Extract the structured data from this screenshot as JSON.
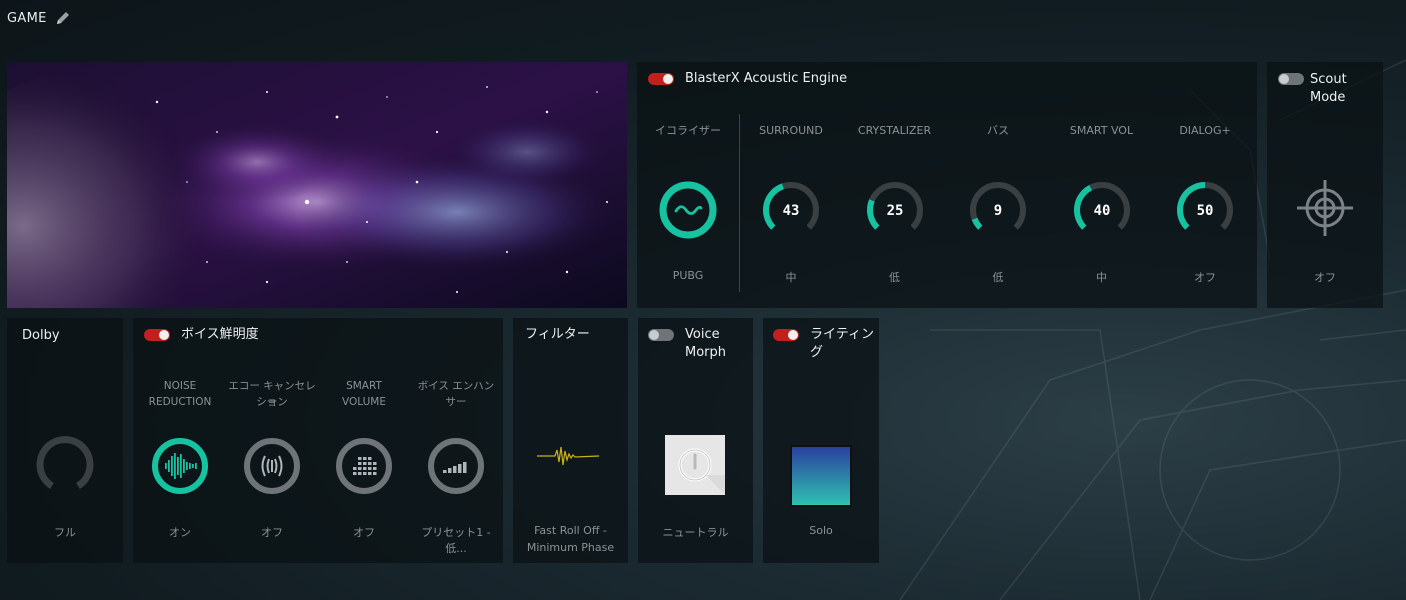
{
  "header": {
    "title": "GAME",
    "edit_icon": "pencil-icon"
  },
  "acoustic_engine": {
    "title": "BlasterX Acoustic Engine",
    "enabled": true,
    "equalizer": {
      "label": "イコライザー",
      "value": "PUBG",
      "icon": "wave-icon"
    },
    "knobs": [
      {
        "label": "SURROUND",
        "number": "43",
        "value": "中",
        "level": 43
      },
      {
        "label": "CRYSTALIZER",
        "number": "25",
        "value": "低",
        "level": 25
      },
      {
        "label": "バス",
        "number": "9",
        "value": "低",
        "level": 9
      },
      {
        "label": "SMART VOL",
        "number": "40",
        "value": "中",
        "level": 40
      },
      {
        "label": "DIALOG+",
        "number": "50",
        "value": "オフ",
        "level": 50
      }
    ]
  },
  "scout_mode": {
    "title_line1": "Scout",
    "title_line2": "Mode",
    "enabled": false,
    "value": "オフ",
    "icon": "crosshair-icon"
  },
  "dolby": {
    "title": "Dolby",
    "value": "フル"
  },
  "voice_clarity": {
    "title": "ボイス鮮明度",
    "enabled": true,
    "items": [
      {
        "label_line1": "NOISE",
        "label_line2": "REDUCTION",
        "value": "オン",
        "active": true,
        "icon": "noise-reduction-icon"
      },
      {
        "label_line1": "エコー キャンセレー",
        "label_line2": "ション",
        "value": "オフ",
        "active": false,
        "icon": "echo-cancellation-icon"
      },
      {
        "label_line1": "SMART",
        "label_line2": "VOLUME",
        "value": "オフ",
        "active": false,
        "icon": "smart-volume-icon"
      },
      {
        "label_line1": "ボイス エンハン",
        "label_line2": "サー",
        "value": "プリセット1 - 低...",
        "active": false,
        "icon": "voice-enhancer-icon"
      }
    ]
  },
  "filter": {
    "title": "フィルター",
    "value_line1": "Fast Roll Off -",
    "value_line2": "Minimum Phase",
    "icon": "waveform-icon"
  },
  "voice_morph": {
    "title_line1": "Voice",
    "title_line2": "Morph",
    "enabled": false,
    "value": "ニュートラル",
    "icon": "power-icon"
  },
  "lighting": {
    "title_line1": "ライティン",
    "title_line2": "グ",
    "enabled": true,
    "value": "Solo",
    "icon": "color-swatch-icon"
  },
  "colors": {
    "accent": "#17c2a0",
    "toggle_on": "#c21f1f",
    "ring_track": "#3a3f42"
  }
}
